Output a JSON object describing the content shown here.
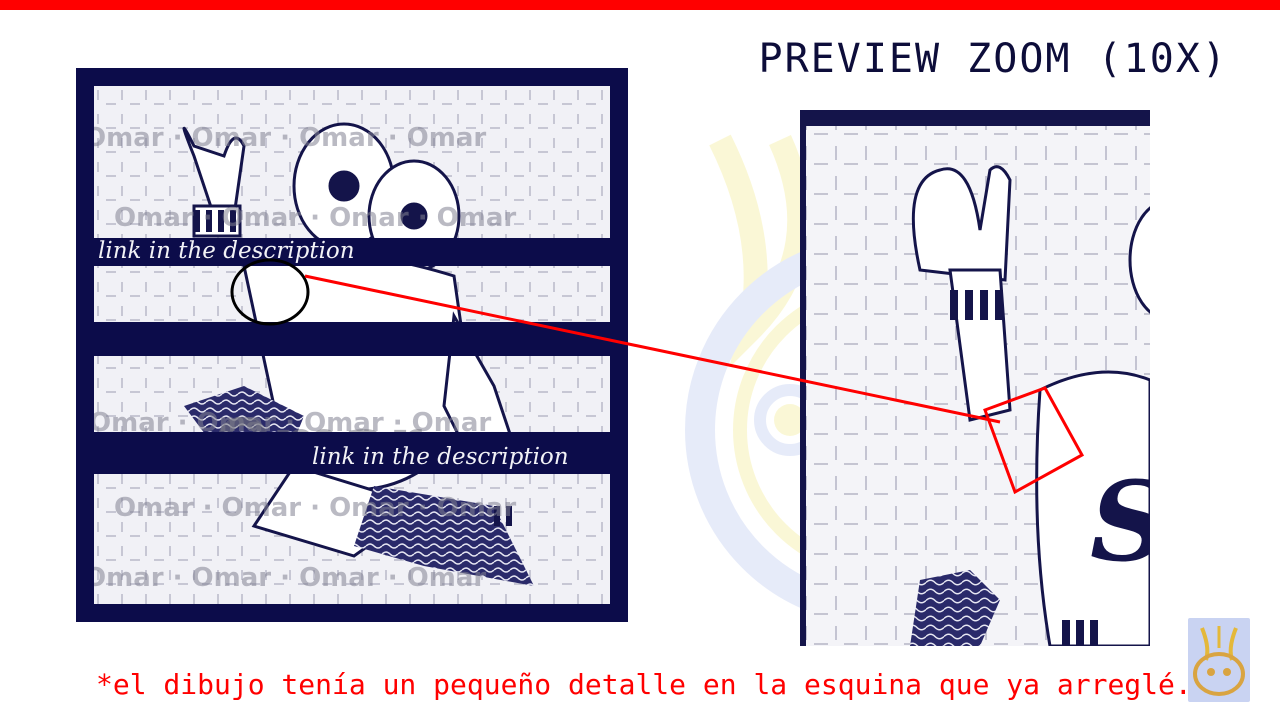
{
  "title": "PREVIEW ZOOM (10X)",
  "preview": {
    "caption_top": "link in the description",
    "caption_bottom": "link in the description",
    "watermark_text": "Omar"
  },
  "zoom": {
    "letter": "S"
  },
  "footnote": "*el dibujo tenía un pequeño detalle en la esquina que ya arreglé.",
  "colors": {
    "accent_red": "#ff0000",
    "navy": "#0c0c4a",
    "pale_yellow": "#f6efa6",
    "pale_blue": "#c9d3f2"
  }
}
